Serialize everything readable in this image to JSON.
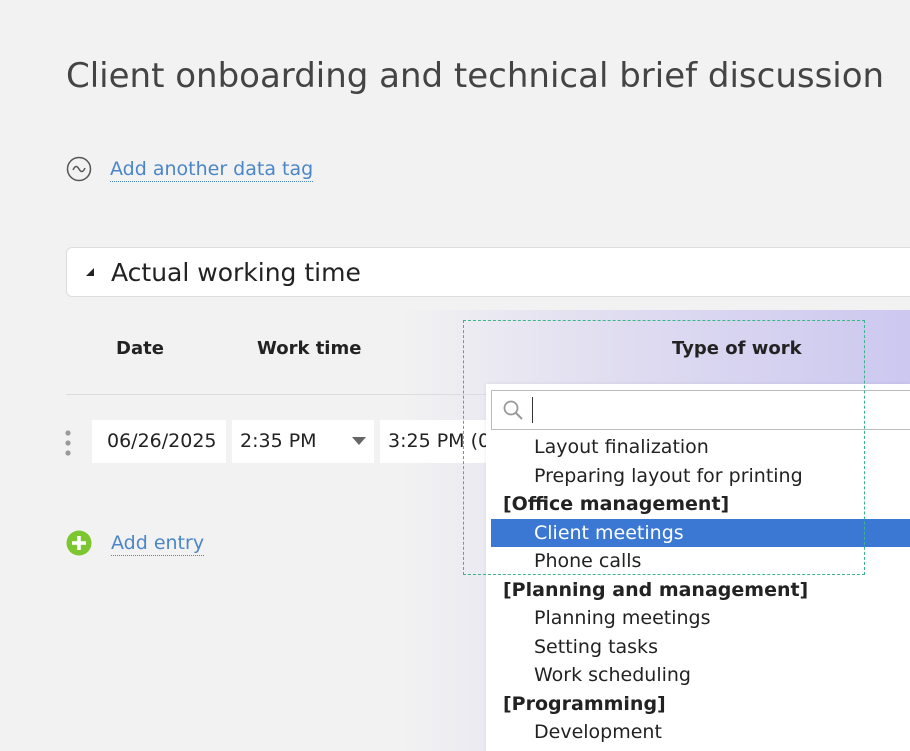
{
  "page": {
    "title": "Client onboarding and technical brief discussion"
  },
  "data_tag": {
    "link_label": "Add another data tag"
  },
  "section": {
    "title": "Actual working time"
  },
  "table": {
    "columns": [
      "Date",
      "Work time",
      "Type of work"
    ],
    "row": {
      "date": "06/26/2025",
      "start_time": "2:35 PM",
      "end_time": "3:25 PM (0"
    }
  },
  "add_entry": {
    "label": "Add entry"
  },
  "dropdown": {
    "search_value": "",
    "options": [
      {
        "label": "Layout finalization",
        "type": "item"
      },
      {
        "label": "Preparing layout for printing",
        "type": "item"
      },
      {
        "label": "[Office management]",
        "type": "group"
      },
      {
        "label": "Client meetings",
        "type": "item",
        "selected": true
      },
      {
        "label": "Phone calls",
        "type": "item"
      },
      {
        "label": "[Planning and management]",
        "type": "group"
      },
      {
        "label": "Planning meetings",
        "type": "item"
      },
      {
        "label": "Setting tasks",
        "type": "item"
      },
      {
        "label": "Work scheduling",
        "type": "item"
      },
      {
        "label": "[Programming]",
        "type": "group"
      },
      {
        "label": "Development",
        "type": "item"
      }
    ]
  },
  "icons": {
    "data_tag": "wave-circle-icon",
    "collapse": "triangle-collapse-icon",
    "drag": "drag-handle-icon",
    "time_dropdown": "caret-down-icon",
    "add": "plus-circle-icon",
    "search": "search-icon"
  },
  "colors": {
    "link": "#4a86c8",
    "selected_option": "#3a78d4",
    "add_icon": "#7cc62f",
    "selection_marquee": "#3bb58a"
  }
}
